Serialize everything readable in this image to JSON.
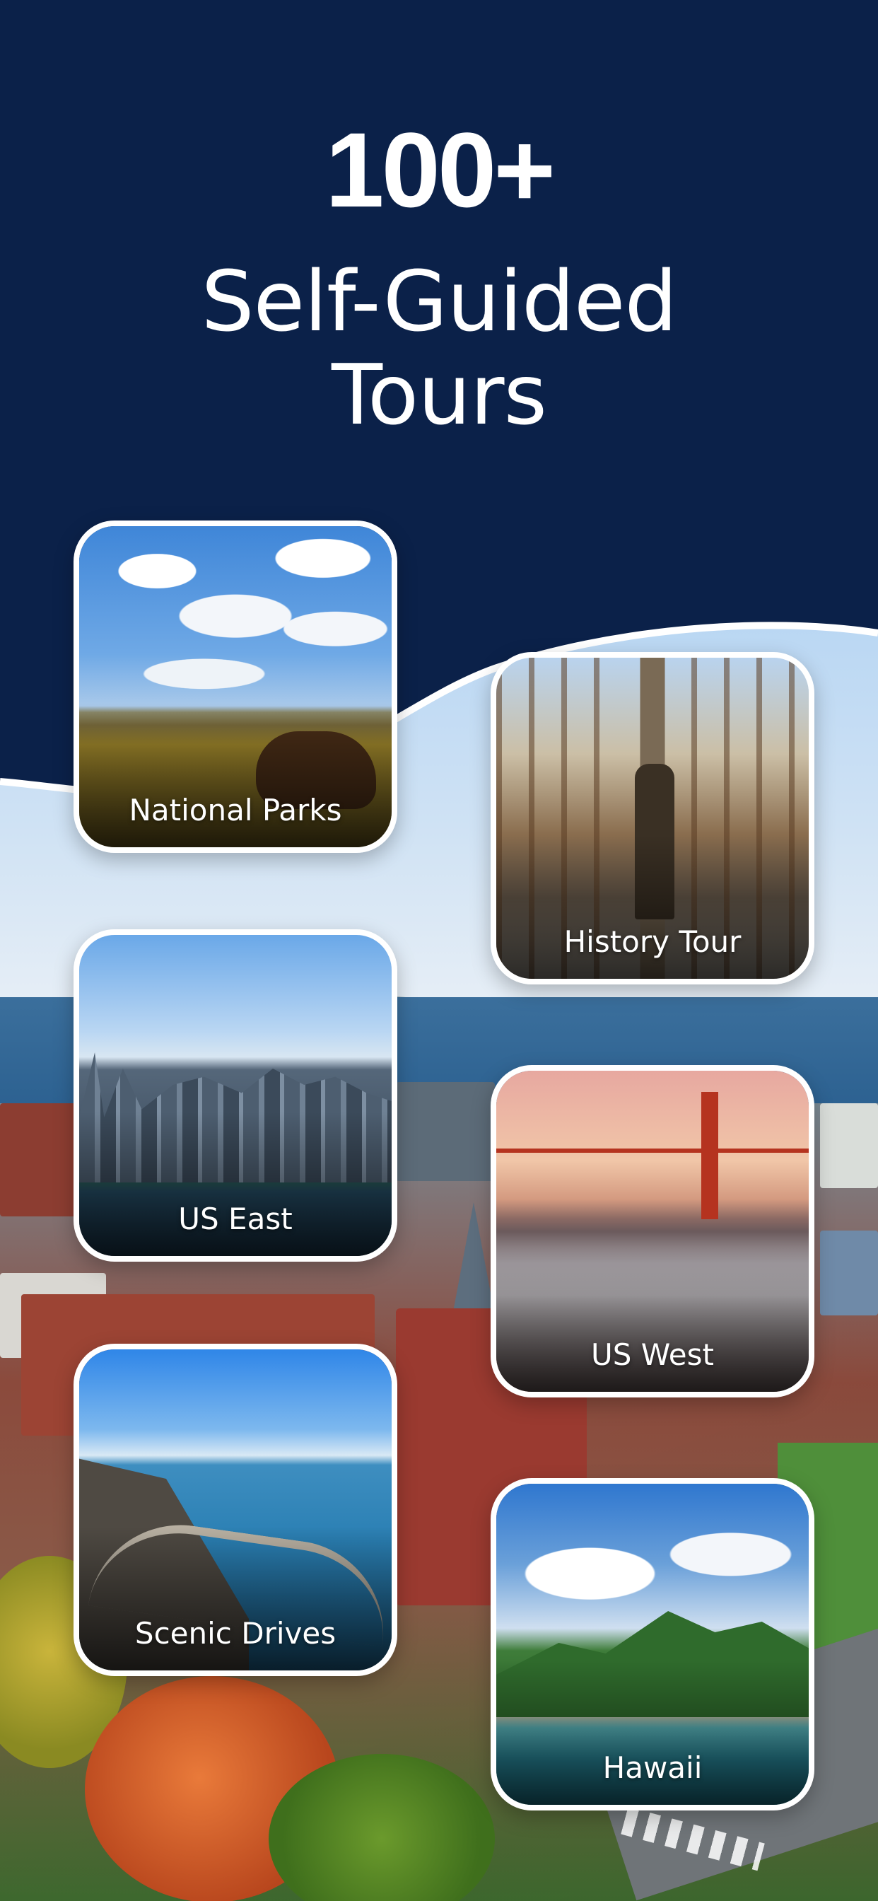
{
  "headline": {
    "count": "100+",
    "subtitle_line1": "Self-Guided",
    "subtitle_line2": "Tours"
  },
  "cards": [
    {
      "label": "National Parks",
      "image": "bison-on-prairie-photo"
    },
    {
      "label": "History Tour",
      "image": "statue-in-tree-lined-plaza-photo"
    },
    {
      "label": "US East",
      "image": "city-skyline-photo"
    },
    {
      "label": "US West",
      "image": "golden-gate-bridge-photo"
    },
    {
      "label": "Scenic Drives",
      "image": "coastal-bridge-photo"
    },
    {
      "label": "Hawaii",
      "image": "tropical-island-photo"
    }
  ],
  "colors": {
    "header_navy": "#0b2149",
    "card_border": "#ffffff",
    "text": "#ffffff"
  },
  "background": {
    "image": "aerial-city-harbor-photo"
  }
}
